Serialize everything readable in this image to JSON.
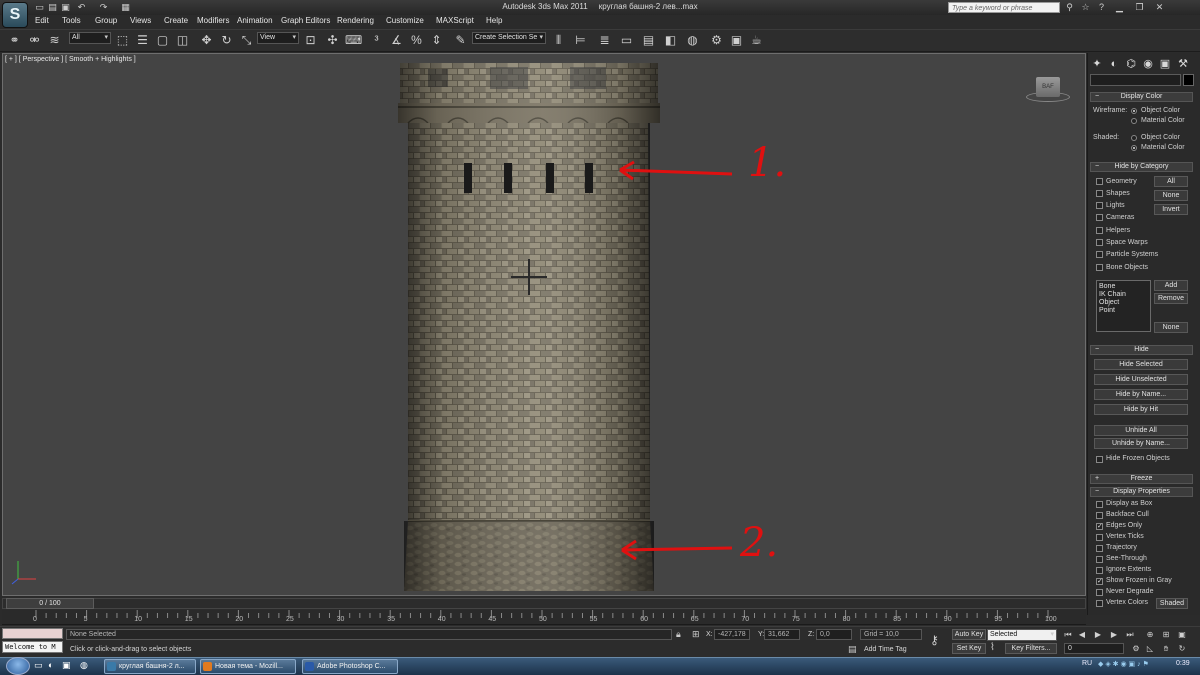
{
  "app": {
    "title": "Autodesk 3ds Max  2011",
    "file": "круглая башня-2 лев...max",
    "logo_glyph": "S",
    "search_placeholder": "Type a keyword or phrase"
  },
  "quick_access": [
    "new-icon",
    "open-icon",
    "save-icon",
    "undo-icon",
    "redo-icon",
    "project-icon"
  ],
  "title_icons": [
    "binoculars-icon",
    "star-icon",
    "help-icon",
    "minimize-icon",
    "restore-icon",
    "close-icon"
  ],
  "menu": [
    "Edit",
    "Tools",
    "Group",
    "Views",
    "Create",
    "Modifiers",
    "Animation",
    "Graph Editors",
    "Rendering",
    "Customize",
    "MAXScript",
    "Help"
  ],
  "toolbar": {
    "filter_value": "All",
    "refcoord_value": "View",
    "selection_set_value": "Create Selection Se"
  },
  "viewport": {
    "label": "[ + ] [ Perspective ] [ Smooth + Highlights ]",
    "viewcube_label": "BAF",
    "annotations": [
      {
        "label": "1.",
        "target": "tower windows"
      },
      {
        "label": "2.",
        "target": "tower base"
      }
    ]
  },
  "command_panel": {
    "tabs": [
      "create-icon",
      "modify-icon",
      "hierarchy-icon",
      "motion-icon",
      "display-icon",
      "utilities-icon"
    ],
    "display_color": {
      "header": "Display Color",
      "wireframe_label": "Wireframe:",
      "shaded_label": "Shaded:",
      "object_color": "Object Color",
      "material_color": "Material Color",
      "wireframe_selected": "Object Color",
      "shaded_selected": "Material Color"
    },
    "hide_by_category": {
      "header": "Hide by Category",
      "categories": [
        "Geometry",
        "Shapes",
        "Lights",
        "Cameras",
        "Helpers",
        "Space Warps",
        "Particle Systems",
        "Bone Objects"
      ],
      "all_label": "All",
      "none_label": "None",
      "invert_label": "Invert",
      "list": [
        "Bone",
        "IK Chain Object",
        "Point"
      ],
      "add_label": "Add",
      "remove_label": "Remove",
      "none2_label": "None"
    },
    "hide": {
      "header": "Hide",
      "buttons": [
        "Hide Selected",
        "Hide Unselected",
        "Hide by Name...",
        "Hide by Hit",
        "Unhide All",
        "Unhide by Name..."
      ],
      "hide_frozen": "Hide Frozen Objects"
    },
    "freeze_header": "Freeze",
    "display_properties": {
      "header": "Display Properties",
      "items": [
        {
          "label": "Display as Box",
          "checked": false
        },
        {
          "label": "Backface Cull",
          "checked": false
        },
        {
          "label": "Edges Only",
          "checked": true
        },
        {
          "label": "Vertex Ticks",
          "checked": false
        },
        {
          "label": "Trajectory",
          "checked": false
        },
        {
          "label": "See-Through",
          "checked": false
        },
        {
          "label": "Ignore Extents",
          "checked": false
        },
        {
          "label": "Show Frozen in Gray",
          "checked": true
        },
        {
          "label": "Never Degrade",
          "checked": false
        },
        {
          "label": "Vertex Colors",
          "checked": false
        }
      ],
      "shaded_button": "Shaded"
    }
  },
  "timeline": {
    "slider_label": "0 / 100",
    "ticks": [
      "0",
      "5",
      "10",
      "15",
      "20",
      "25",
      "30",
      "35",
      "40",
      "45",
      "50",
      "55",
      "60",
      "65",
      "70",
      "75",
      "80",
      "85",
      "90",
      "95",
      "100"
    ]
  },
  "status": {
    "maxscript_text": "Welcome to M",
    "selection": "None Selected",
    "prompt": "Click or click-and-drag to select objects",
    "x_label": "X:",
    "x_value": "-427,178",
    "y_label": "Y:",
    "y_value": "31,662",
    "z_label": "Z:",
    "z_value": "0,0",
    "grid": "Grid = 10,0",
    "add_time_tag": "Add Time Tag",
    "auto_key": "Auto Key",
    "set_key": "Set Key",
    "key_mode": "Selected",
    "key_filters": "Key Filters...",
    "frame": "0"
  },
  "taskbar": {
    "tasks": [
      {
        "label": "круглая башня-2 л...",
        "color": "#3a7aa8"
      },
      {
        "label": "Новая тема - Mozill...",
        "color": "#e07a20"
      },
      {
        "label": "Adobe Photoshop C...",
        "color": "#2a5aa8"
      }
    ],
    "lang": "RU",
    "clock": "0:39"
  }
}
